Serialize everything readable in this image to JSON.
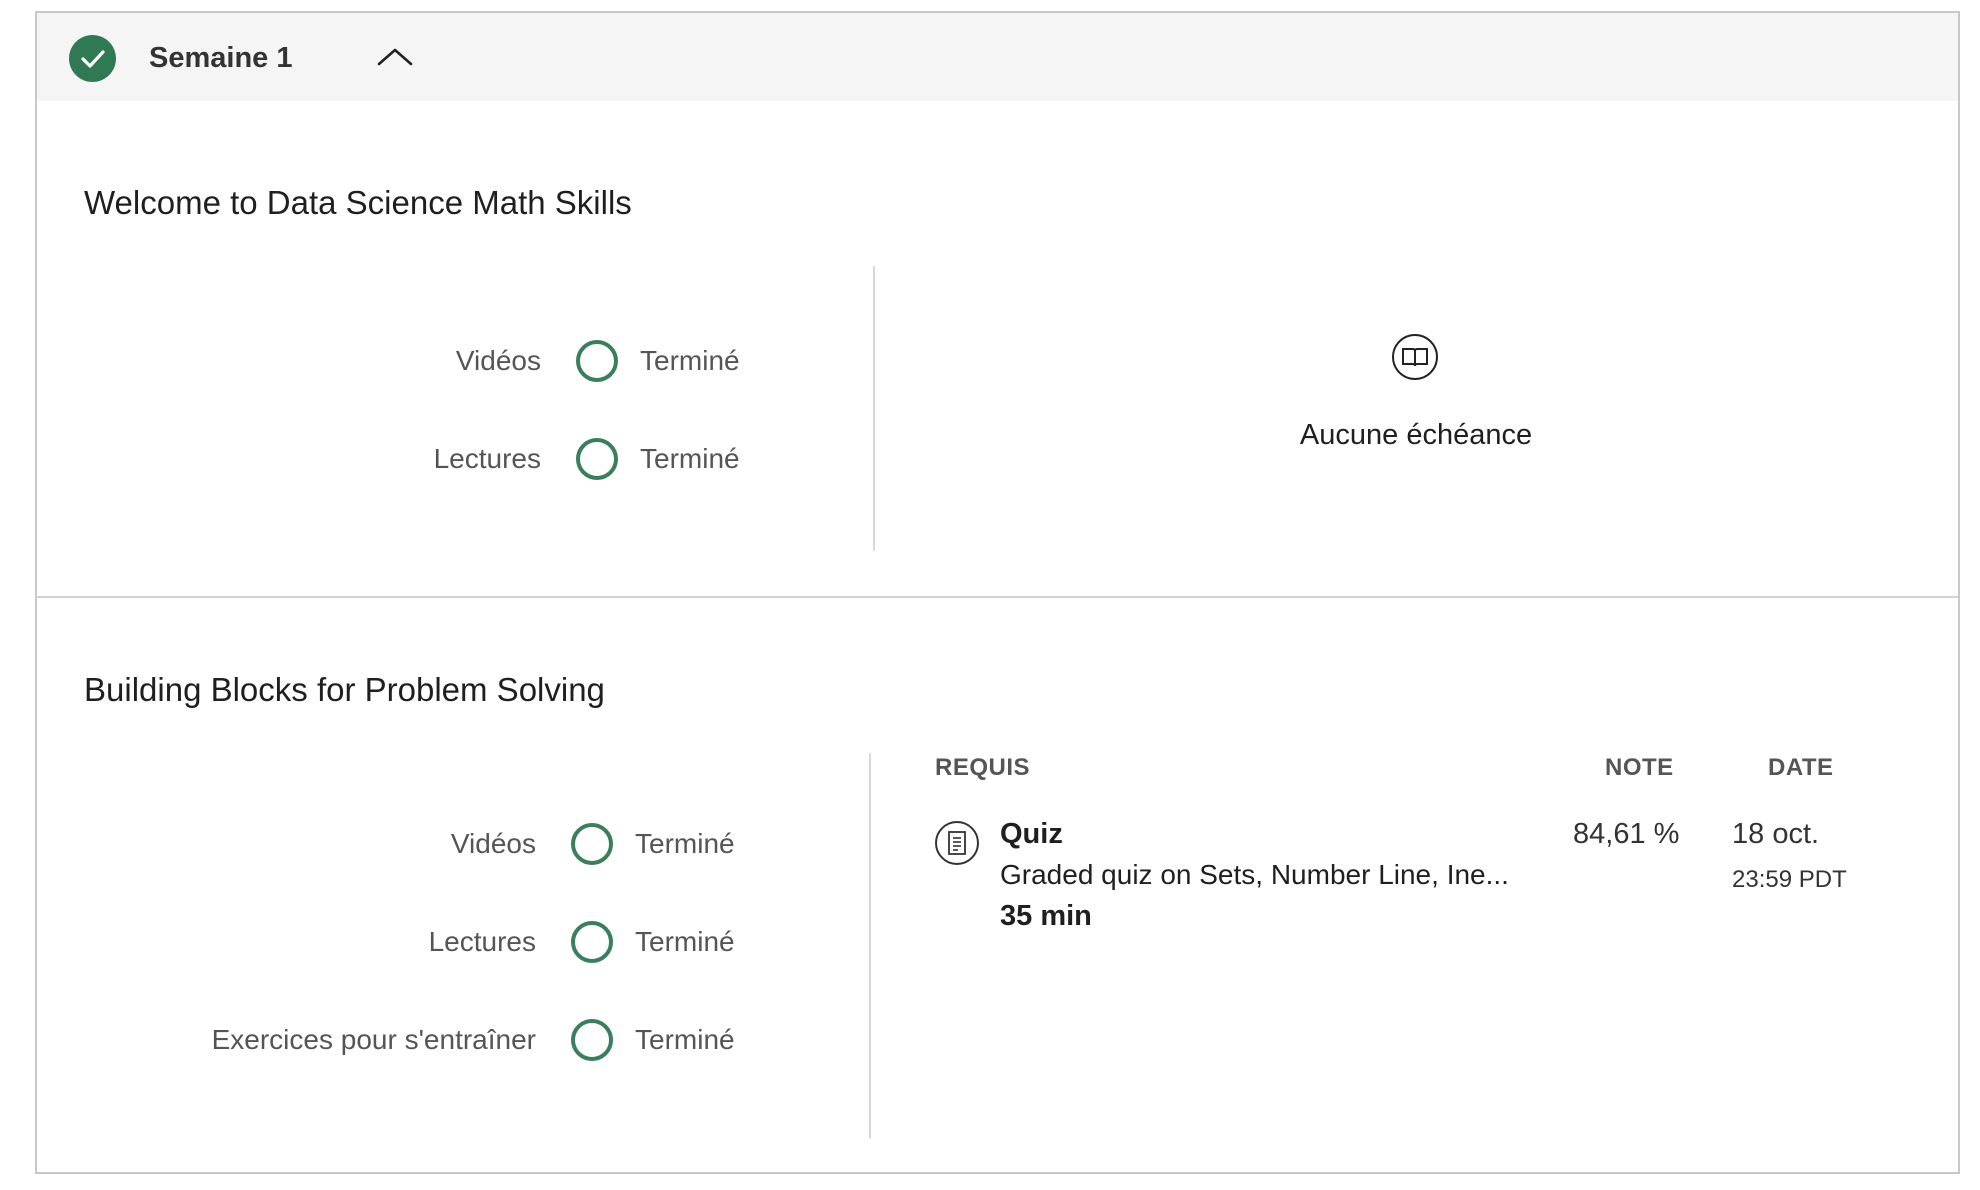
{
  "week": {
    "title": "Semaine 1"
  },
  "modules": [
    {
      "title": "Welcome to Data Science Math Skills",
      "progress": [
        {
          "label": "Vidéos",
          "status": "Terminé"
        },
        {
          "label": "Lectures",
          "status": "Terminé"
        }
      ],
      "deadline": {
        "icon": "book-icon",
        "text": "Aucune échéance"
      }
    },
    {
      "title": "Building Blocks for Problem Solving",
      "progress": [
        {
          "label": "Vidéos",
          "status": "Terminé"
        },
        {
          "label": "Lectures",
          "status": "Terminé"
        },
        {
          "label": "Exercices pour s'entraîner",
          "status": "Terminé"
        }
      ],
      "table": {
        "headers": {
          "required": "REQUIS",
          "grade": "NOTE",
          "date": "DATE"
        },
        "items": [
          {
            "icon": "quiz-icon",
            "title": "Quiz",
            "description": "Graded quiz on Sets, Number Line, Ine...",
            "duration": "35 min",
            "grade": "84,61 %",
            "date": "18 oct.",
            "time": "23:59 PDT"
          }
        ]
      }
    }
  ],
  "colors": {
    "accent_green": "#2f7a55",
    "ring_green": "#3a7e5c",
    "header_bg": "#f5f5f5",
    "border": "#c8c8c8"
  }
}
